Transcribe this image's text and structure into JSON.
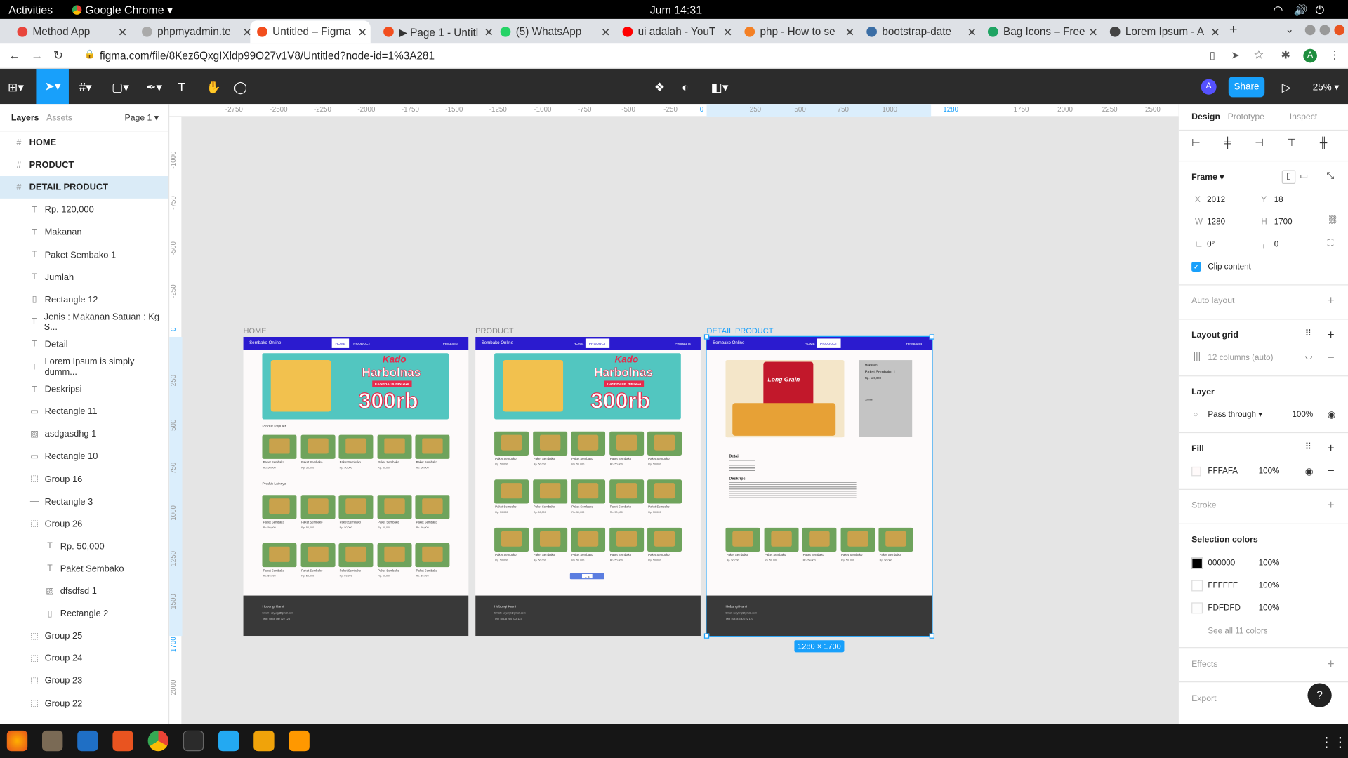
{
  "os": {
    "activities": "Activities",
    "app": "Google Chrome",
    "clock": "Jum 14:31"
  },
  "tabs": [
    {
      "label": "Method App",
      "color": "#e8453c"
    },
    {
      "label": "phpmyadmin.te",
      "color": "#aaaaaa"
    },
    {
      "label": "Untitled – Figma",
      "color": "#f24e1e"
    },
    {
      "label": "▶ Page 1 - Untitl",
      "color": "#f24e1e"
    },
    {
      "label": "(5) WhatsApp",
      "color": "#25d366"
    },
    {
      "label": "ui adalah - YouT",
      "color": "#ff0000"
    },
    {
      "label": "php - How to se",
      "color": "#f48024"
    },
    {
      "label": "bootstrap-date",
      "color": "#3b6ea5"
    },
    {
      "label": "Bag Icons – Free",
      "color": "#1fa463"
    },
    {
      "label": "Lorem Ipsum - A",
      "color": "#444444"
    }
  ],
  "address": "figma.com/file/8Kez6QxgIXldp99O27v1V8/Untitled?node-id=1%3A281",
  "figma": {
    "share": "Share",
    "zoom": "25%",
    "avatar": "A"
  },
  "left": {
    "tab_layers": "Layers",
    "tab_assets": "Assets",
    "page": "Page 1",
    "layers": [
      {
        "label": "HOME",
        "icon": "#",
        "level": 0
      },
      {
        "label": "PRODUCT",
        "icon": "#",
        "level": 0
      },
      {
        "label": "DETAIL PRODUCT",
        "icon": "#",
        "level": 0,
        "selected": true
      },
      {
        "label": "Rp. 120,000",
        "icon": "T",
        "level": 1
      },
      {
        "label": "Makanan",
        "icon": "T",
        "level": 1
      },
      {
        "label": "Paket Sembako 1",
        "icon": "T",
        "level": 1
      },
      {
        "label": "Jumlah",
        "icon": "T",
        "level": 1
      },
      {
        "label": "Rectangle 12",
        "icon": "▯",
        "level": 1
      },
      {
        "label": "Jenis : Makanan Satuan : Kg S...",
        "icon": "T",
        "level": 1
      },
      {
        "label": "Detail",
        "icon": "T",
        "level": 1
      },
      {
        "label": "Lorem Ipsum is simply dumm...",
        "icon": "T",
        "level": 1
      },
      {
        "label": "Deskripsi",
        "icon": "T",
        "level": 1
      },
      {
        "label": "Rectangle 11",
        "icon": "▭",
        "level": 1
      },
      {
        "label": "asdgasdhg 1",
        "icon": "▨",
        "level": 1
      },
      {
        "label": "Rectangle 10",
        "icon": "▭",
        "level": 1
      },
      {
        "label": "Group 16",
        "icon": "⬚",
        "level": 1
      },
      {
        "label": "Rectangle 3",
        "icon": "—",
        "level": 1
      },
      {
        "label": "Group 26",
        "icon": "⬚",
        "level": 1
      },
      {
        "label": "Rp. 50,000",
        "icon": "T",
        "level": 2
      },
      {
        "label": "Paket Sembako",
        "icon": "T",
        "level": 2
      },
      {
        "label": "dfsdfsd 1",
        "icon": "▨",
        "level": 2
      },
      {
        "label": "Rectangle 2",
        "icon": "▯",
        "level": 2
      },
      {
        "label": "Group 25",
        "icon": "⬚",
        "level": 1
      },
      {
        "label": "Group 24",
        "icon": "⬚",
        "level": 1
      },
      {
        "label": "Group 23",
        "icon": "⬚",
        "level": 1
      },
      {
        "label": "Group 22",
        "icon": "⬚",
        "level": 1
      }
    ]
  },
  "ruler": {
    "h": [
      "-2750",
      "-2500",
      "-2250",
      "-2000",
      "-1750",
      "-1500",
      "-1250",
      "-1000",
      "-750",
      "-500",
      "-250",
      "0",
      "250",
      "500",
      "750",
      "1000",
      "1280",
      "1750",
      "2000",
      "2250",
      "2500"
    ],
    "v": [
      "-1000",
      "-750",
      "-500",
      "-250",
      "0",
      "250",
      "500",
      "750",
      "1000",
      "1250",
      "1500",
      "1700",
      "2000"
    ]
  },
  "frames": [
    {
      "label": "HOME",
      "brand": "Sembako Online",
      "nav_home": "HOME",
      "nav_product": "PRODUCT",
      "nav_user": "Pengguna",
      "section1": "Produk Populer",
      "section2": "Produk Lainnya"
    },
    {
      "label": "PRODUCT",
      "brand": "Sembako Online",
      "nav_home": "HOME",
      "nav_product": "PRODUCT",
      "nav_user": "Pengguna",
      "pagination": "1 2"
    },
    {
      "label": "DETAIL PRODUCT",
      "brand": "Sembako Online",
      "nav_home": "HOME",
      "nav_product": "PRODUCT",
      "nav_user": "Pengguna",
      "category": "Makanan",
      "title": "Paket Sembako 1",
      "price": "Rp. 120,000",
      "jumlah": "Jumlah",
      "detail": "Detail",
      "deskripsi": "Deskripsi",
      "size_badge": "1280 × 1700"
    }
  ],
  "banner": {
    "line1": "Kado",
    "line2": "Harbolnas",
    "line3": "CASHBACK HINGGA",
    "line4": "300rb",
    "brand": "Long Grain"
  },
  "product_card": {
    "name": "Paket Sembako",
    "price": "Rp. 50,000"
  },
  "footer": {
    "title": "Hubungi Kami",
    "email": "Email : usyurgi@gmail.com",
    "phone": "Telp : 0878 780 722 123"
  },
  "right": {
    "tabs": [
      "Design",
      "Prototype",
      "Inspect"
    ],
    "frame": "Frame",
    "x_label": "X",
    "x": "2012",
    "y_label": "Y",
    "y": "18",
    "w_label": "W",
    "w": "1280",
    "h_label": "H",
    "h": "1700",
    "rot": "0°",
    "radius": "0",
    "clip": "Clip content",
    "auto_layout": "Auto layout",
    "layout_grid": "Layout grid",
    "grid_value": "12 columns (auto)",
    "layer": "Layer",
    "blend": "Pass through",
    "opacity": "100%",
    "fill": "Fill",
    "fill_hex": "FFFAFA",
    "fill_opacity": "100%",
    "stroke": "Stroke",
    "selection_colors": "Selection colors",
    "colors": [
      {
        "hex": "000000",
        "swatch": "#000000",
        "op": "100%"
      },
      {
        "hex": "FFFFFF",
        "swatch": "#FFFFFF",
        "op": "100%"
      },
      {
        "hex": "FDFDFD",
        "swatch": "#FDFDFD",
        "op": "100%"
      }
    ],
    "see_all": "See all 11 colors",
    "effects": "Effects",
    "export": "Export",
    "help": "?"
  },
  "accent": "#18a0fb"
}
